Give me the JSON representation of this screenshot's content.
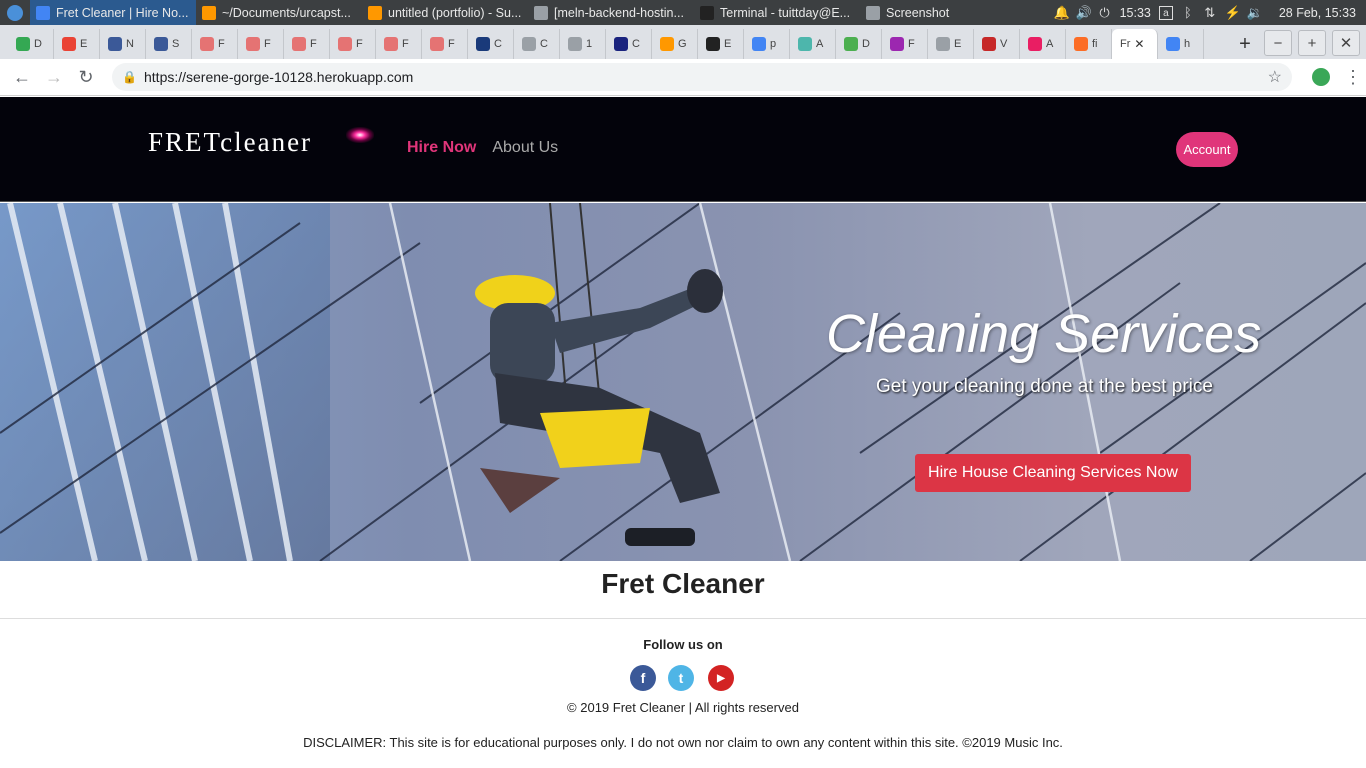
{
  "taskbar": {
    "tasks": [
      {
        "label": "Fret Cleaner | Hire No...",
        "icon": "chrome-icon",
        "color": "#4285f4"
      },
      {
        "label": "~/Documents/urcapst...",
        "icon": "sublime-icon",
        "color": "#ff9800"
      },
      {
        "label": "untitled (portfolio) - Su...",
        "icon": "sublime-icon",
        "color": "#ff9800"
      },
      {
        "label": "[meln-backend-hostin...",
        "icon": "folder-icon",
        "color": "#9aa0a6"
      },
      {
        "label": "Terminal - tuittday@E...",
        "icon": "terminal-icon",
        "color": "#222222"
      },
      {
        "label": "Screenshot",
        "icon": "camera-icon",
        "color": "#9aa0a6"
      }
    ],
    "clock": "15:33",
    "date": "28 Feb, 15:33"
  },
  "browser": {
    "tabs": [
      {
        "label": "D",
        "color": "#34a853"
      },
      {
        "label": "E",
        "color": "#ea4335"
      },
      {
        "label": "N",
        "color": "#3b5998"
      },
      {
        "label": "S",
        "color": "#3b5998"
      },
      {
        "label": "F",
        "color": "#e57373"
      },
      {
        "label": "F",
        "color": "#e57373"
      },
      {
        "label": "F",
        "color": "#e57373"
      },
      {
        "label": "F",
        "color": "#e57373"
      },
      {
        "label": "F",
        "color": "#e57373"
      },
      {
        "label": "F",
        "color": "#e57373"
      },
      {
        "label": "C",
        "color": "#1a3a7a"
      },
      {
        "label": "C",
        "color": "#9aa0a6"
      },
      {
        "label": "1",
        "color": "#9aa0a6"
      },
      {
        "label": "C",
        "color": "#1a237e"
      },
      {
        "label": "G",
        "color": "#ff9800"
      },
      {
        "label": "E",
        "color": "#222222"
      },
      {
        "label": "p",
        "color": "#4285f4"
      },
      {
        "label": "A",
        "color": "#4db6ac"
      },
      {
        "label": "D",
        "color": "#4caf50"
      },
      {
        "label": "F",
        "color": "#9c27b0"
      },
      {
        "label": "E",
        "color": "#9aa0a6"
      },
      {
        "label": "V",
        "color": "#c62828"
      },
      {
        "label": "A",
        "color": "#e91e63"
      },
      {
        "label": "fi",
        "color": "#fc6d26"
      }
    ],
    "active_tab": "Fr",
    "last_tab": "h",
    "url": "https://serene-gorge-10128.herokuapp.com"
  },
  "site": {
    "brand": "FRETcleaner",
    "nav": {
      "hire": "Hire Now",
      "about": "About Us"
    },
    "account": "Account",
    "hero": {
      "title": "Cleaning Services",
      "subtitle": "Get your cleaning done at the best price",
      "cta": "Hire House Cleaning Services Now"
    },
    "page_name": "Fret Cleaner",
    "follow": "Follow us on",
    "socials": [
      {
        "name": "facebook",
        "glyph": "f"
      },
      {
        "name": "twitter",
        "glyph": "t"
      },
      {
        "name": "youtube",
        "glyph": "▶"
      }
    ],
    "copyright": "© 2019 Fret Cleaner | All rights reserved",
    "disclaimer": "DISCLAIMER: This site is for educational purposes only. I do not own nor claim to own any content within this site. ©2019 Music Inc."
  },
  "colors": {
    "header_bg": "#03030b",
    "accent_pink": "#e0357a",
    "cta_red": "#dc3545"
  }
}
